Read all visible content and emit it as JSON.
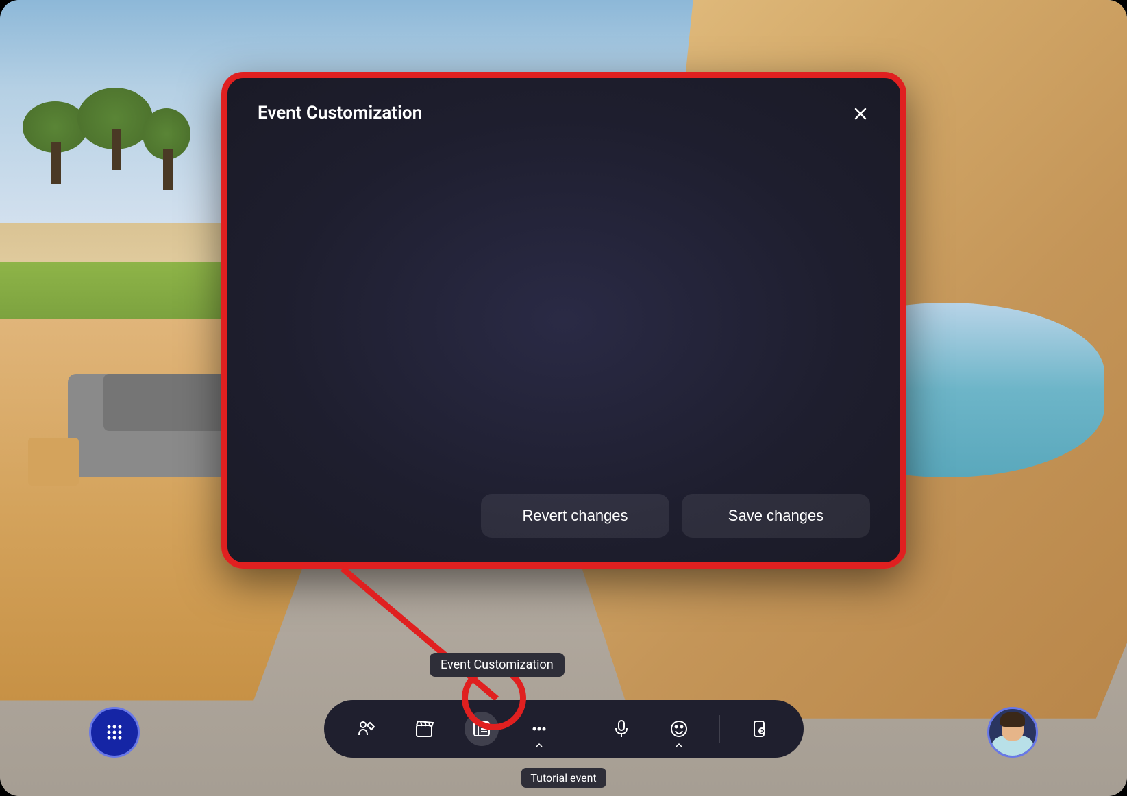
{
  "modal": {
    "title": "Event Customization",
    "revert_label": "Revert changes",
    "save_label": "Save changes"
  },
  "tooltip": {
    "text": "Event Customization"
  },
  "toolbar": {
    "icons": {
      "customize": "customize-avatar-icon",
      "clapperboard": "clapperboard-icon",
      "event": "event-panel-icon",
      "more": "more-icon",
      "mic": "microphone-icon",
      "emoji": "emoji-icon",
      "exit": "exit-icon"
    }
  },
  "event_label": "Tutorial event",
  "colors": {
    "highlight": "#e02020",
    "accent": "#6878e8",
    "panel_bg": "#1f1f2e"
  }
}
